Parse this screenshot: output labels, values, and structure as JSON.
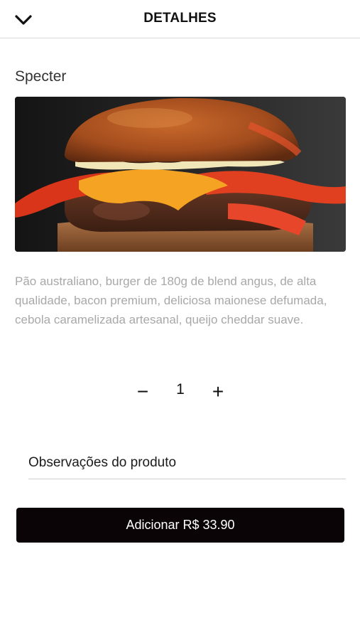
{
  "header": {
    "title": "DETALHES",
    "back_icon": "chevron-down-icon"
  },
  "product": {
    "name": "Specter",
    "image_icon": "burger-photo",
    "description": "Pão australiano, burger de 180g de blend angus, de alta qualidade, bacon premium, deliciosa maionese defumada, cebola caramelizada artesanal, queijo cheddar suave."
  },
  "quantity": {
    "minus_label": "−",
    "value": "1",
    "plus_label": "+"
  },
  "observations": {
    "placeholder": "Observações do produto",
    "value": ""
  },
  "add_button": {
    "label": "Adicionar R$ 33.90"
  },
  "colors": {
    "button_bg": "#0a0406",
    "description_text": "#a8a8a8",
    "divider": "#dcdcdc"
  }
}
